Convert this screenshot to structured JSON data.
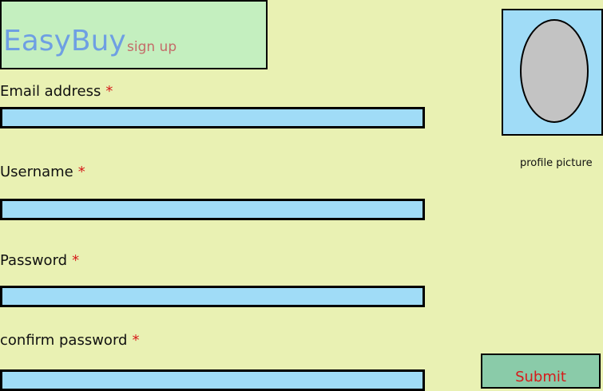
{
  "header": {
    "brand": "EasyBuy",
    "subtitle": "sign up"
  },
  "form": {
    "required_marker": "*",
    "email": {
      "label": "Email address",
      "value": ""
    },
    "username": {
      "label": "Username",
      "value": ""
    },
    "password": {
      "label": "Password",
      "value": ""
    },
    "confirm_password": {
      "label": "confirm password",
      "value": ""
    }
  },
  "profile": {
    "caption": "profile picture"
  },
  "actions": {
    "submit_label": "Submit"
  },
  "colors": {
    "background": "#e9f1b3",
    "header_background": "#c4efbf",
    "brand_text": "#6e9fe3",
    "subtitle_text": "#c46b69",
    "input_background": "#a0dcf7",
    "avatar_placeholder": "#c3c3c3",
    "required_marker": "#d61b1b",
    "submit_background": "#8acba9",
    "submit_text": "#d61b1b"
  },
  "icons": {
    "avatar": "avatar-placeholder-icon"
  }
}
